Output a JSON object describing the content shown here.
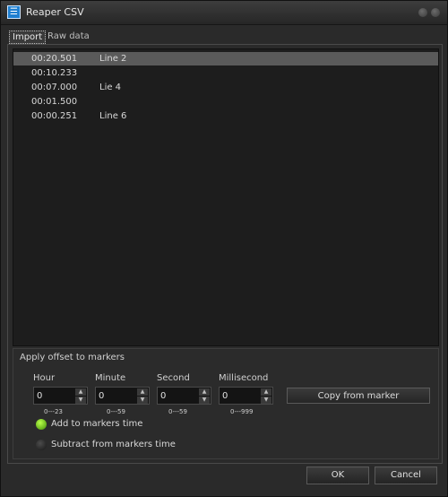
{
  "window": {
    "title": "Reaper CSV"
  },
  "tabs": {
    "import": "Import",
    "raw": "Raw data"
  },
  "rows": [
    {
      "time": "00:20.501",
      "name": "Line 2",
      "selected": true
    },
    {
      "time": "00:10.233",
      "name": ""
    },
    {
      "time": "00:07.000",
      "name": "Lie 4"
    },
    {
      "time": "00:01.500",
      "name": ""
    },
    {
      "time": "00:00.251",
      "name": "Line 6"
    }
  ],
  "offset": {
    "title": "Apply offset to markers",
    "hour": {
      "label": "Hour",
      "value": "0",
      "range": "0---23"
    },
    "minute": {
      "label": "Minute",
      "value": "0",
      "range": "0---59"
    },
    "second": {
      "label": "Second",
      "value": "0",
      "range": "0---59"
    },
    "ms": {
      "label": "Millisecond",
      "value": "0",
      "range": "0---999"
    },
    "copy_label": "Copy from marker",
    "add_label": "Add to markers time",
    "subtract_label": "Subtract from markers time",
    "selected_mode": "add"
  },
  "buttons": {
    "ok": "OK",
    "cancel": "Cancel"
  },
  "colors": {
    "radio_on": "#7fd31a",
    "selection": "#5a5a5a"
  }
}
